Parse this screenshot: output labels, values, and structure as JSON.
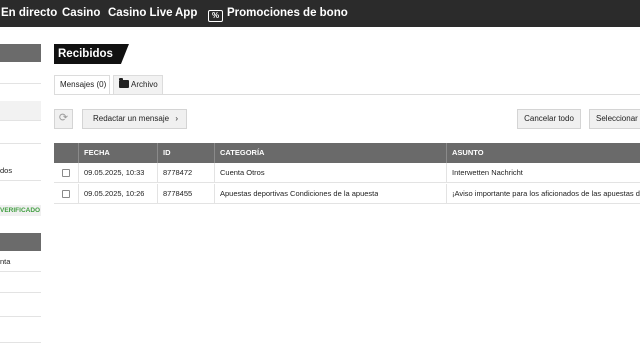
{
  "nav": {
    "items": [
      "En directo",
      "Casino",
      "Casino Live",
      "App"
    ],
    "promo_icon": "%",
    "promo_label": "Promociones de bono"
  },
  "sidebar": {
    "row_text_1": "dos",
    "verified_badge": "VERIFICADO",
    "row_text_2": "nta"
  },
  "page": {
    "title": "Recibidos"
  },
  "tabs": {
    "messages_label": "Mensajes (0)",
    "archive_label": "Archivo"
  },
  "toolbar": {
    "refresh_icon": "⟳",
    "compose_label": "Redactar un mensaje",
    "compose_chevron": "›",
    "cancel_all_label": "Cancelar todo",
    "select_label": "Seleccionar todo"
  },
  "table": {
    "headers": [
      "FECHA",
      "ID",
      "CATEGORÍA",
      "ASUNTO"
    ],
    "rows": [
      {
        "date": "09.05.2025, 10:33",
        "id": "8778472",
        "category": "Cuenta Otros",
        "subject": "Interwetten Nachricht"
      },
      {
        "date": "09.05.2025, 10:26",
        "id": "8778455",
        "category": "Apuestas deportivas Condiciones de la apuesta",
        "subject": "¡Aviso importante para los aficionados de las apuestas deportivas!"
      }
    ]
  },
  "colors": {
    "nav_bg": "#2b2b2b",
    "table_header_bg": "#6a6a6a",
    "verified_green": "#3f9e3f"
  }
}
